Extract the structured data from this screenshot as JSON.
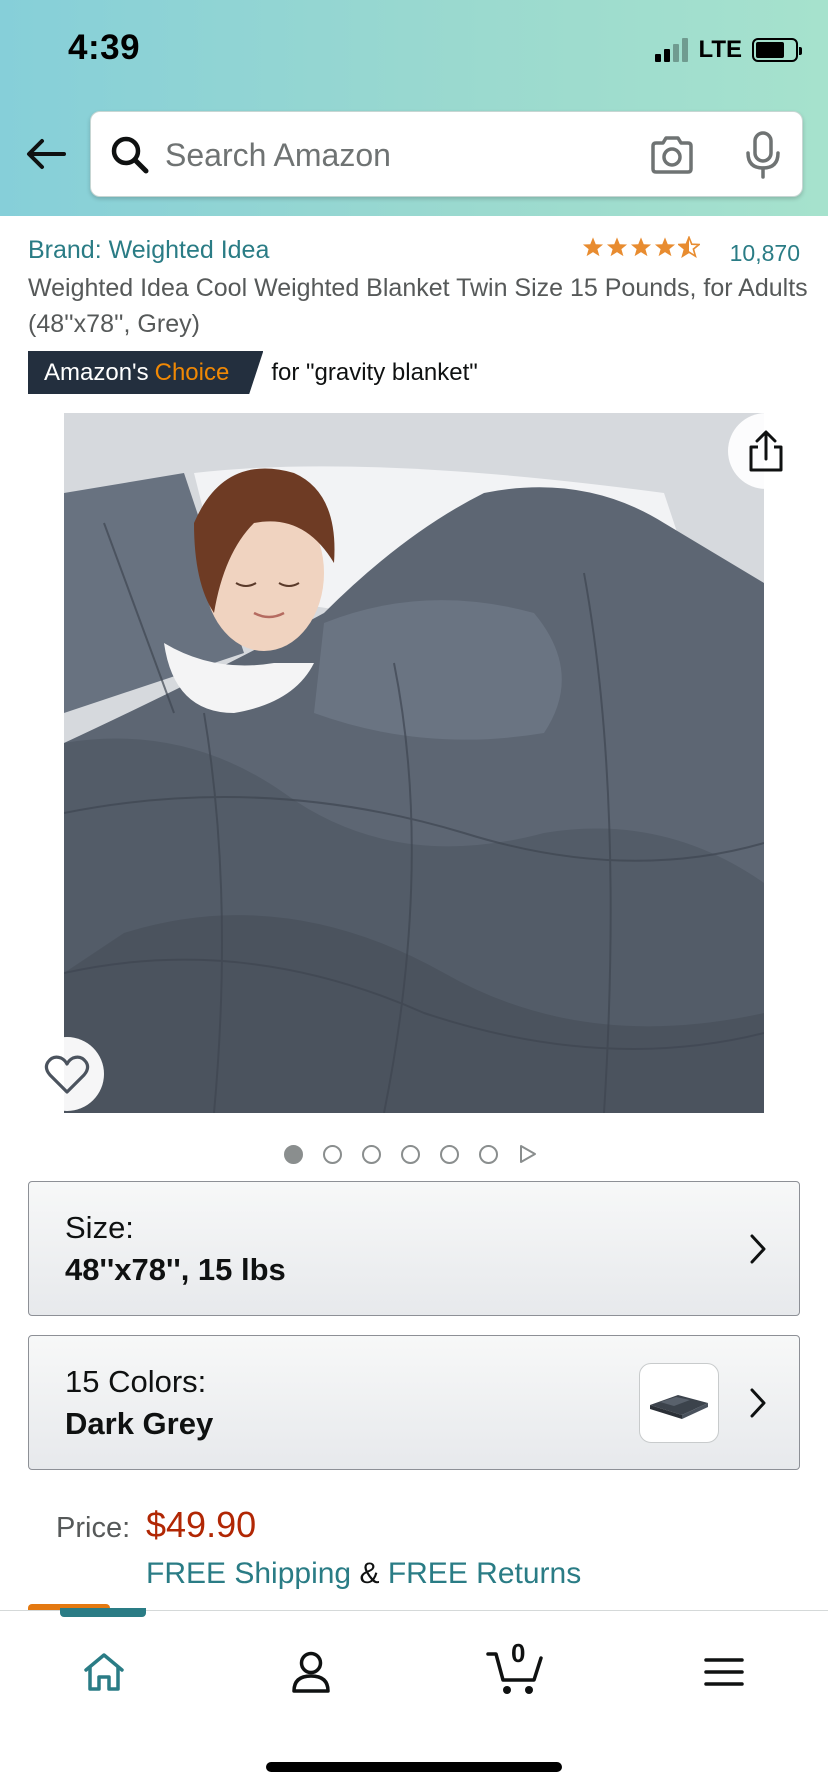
{
  "status_bar": {
    "time": "4:39",
    "network": "LTE"
  },
  "search": {
    "placeholder": "Search Amazon"
  },
  "product": {
    "brand": "Brand: Weighted Idea",
    "rating_stars": 4.5,
    "rating_count": "10,870",
    "title": "Weighted Idea Cool Weighted Blanket Twin Size 15 Pounds, for Adults (48''x78'', Grey)",
    "choice_badge_prefix": "Amazon's",
    "choice_badge_accent": "Choice",
    "choice_for": "for \"gravity blanket\"",
    "image_count": 6,
    "active_image_index": 0
  },
  "variations": {
    "size_label": "Size:",
    "size_value": "48''x78'', 15 lbs",
    "color_label": "15 Colors:",
    "color_value": "Dark Grey"
  },
  "price": {
    "label": "Price:",
    "value": "$49.90",
    "free_shipping": "FREE Shipping",
    "ampersand": "&",
    "free_returns": "FREE Returns"
  },
  "nav": {
    "items": [
      "home-icon",
      "account-icon",
      "cart-icon",
      "menu-icon"
    ],
    "cart_count": "0"
  },
  "colors": {
    "header_gradient_start": "#86cfd9",
    "header_gradient_end": "#a6e2cd",
    "link_teal": "#2a7c85",
    "price_red": "#b12704",
    "badge_dark": "#232f3e",
    "badge_orange": "#f08804",
    "star_orange": "#e88c30"
  }
}
